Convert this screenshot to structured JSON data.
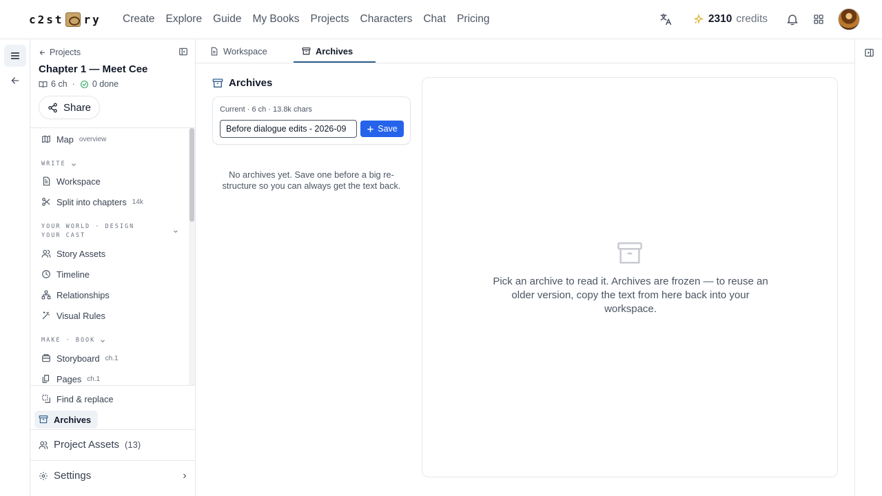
{
  "header": {
    "logo_text": "c2story",
    "nav": [
      "Create",
      "Explore",
      "Guide",
      "My Books",
      "Projects",
      "Characters",
      "Chat",
      "Pricing"
    ],
    "credits_value": "2310",
    "credits_label": "credits"
  },
  "sidebar": {
    "back_label": "Projects",
    "title": "Chapter 1 — Meet Cee",
    "chapters": "6 ch",
    "meta_separator": "·",
    "done": "0 done",
    "share_label": "Share",
    "items": [
      {
        "label": "Map",
        "badge": "overview"
      },
      {
        "section": "WRITE"
      },
      {
        "label": "Workspace",
        "badge": ""
      },
      {
        "label": "Split into chapters",
        "badge": "14k"
      },
      {
        "section": "YOUR WORLD · DESIGN YOUR CAST"
      },
      {
        "label": "Story Assets"
      },
      {
        "label": "Timeline"
      },
      {
        "label": "Relationships"
      },
      {
        "label": "Visual Rules"
      },
      {
        "section": "MAKE · BOOK"
      },
      {
        "label": "Storyboard",
        "badge": "ch.1"
      },
      {
        "label": "Pages",
        "badge": "ch.1"
      }
    ],
    "find_replace": "Find & replace",
    "archives": "Archives",
    "project_assets": "Project Assets",
    "project_assets_count": "(13)",
    "settings": "Settings"
  },
  "tabs": [
    "Workspace",
    "Archives"
  ],
  "archives": {
    "title": "Archives",
    "current_meta": "Current · 6 ch · 13.8k chars",
    "input_value": "Before dialogue edits - 2026-09",
    "save_label": "Save",
    "empty_text": "No archives yet. Save one before a big re-structure so you can always get the text back.",
    "reader_text": "Pick an archive to read it. Archives are frozen — to reuse an older version, copy the text from here back into your workspace."
  },
  "colors": {
    "accent": "#2563eb",
    "tab_underline": "#2f5d8a",
    "credits_icon": "#e0b43a"
  }
}
